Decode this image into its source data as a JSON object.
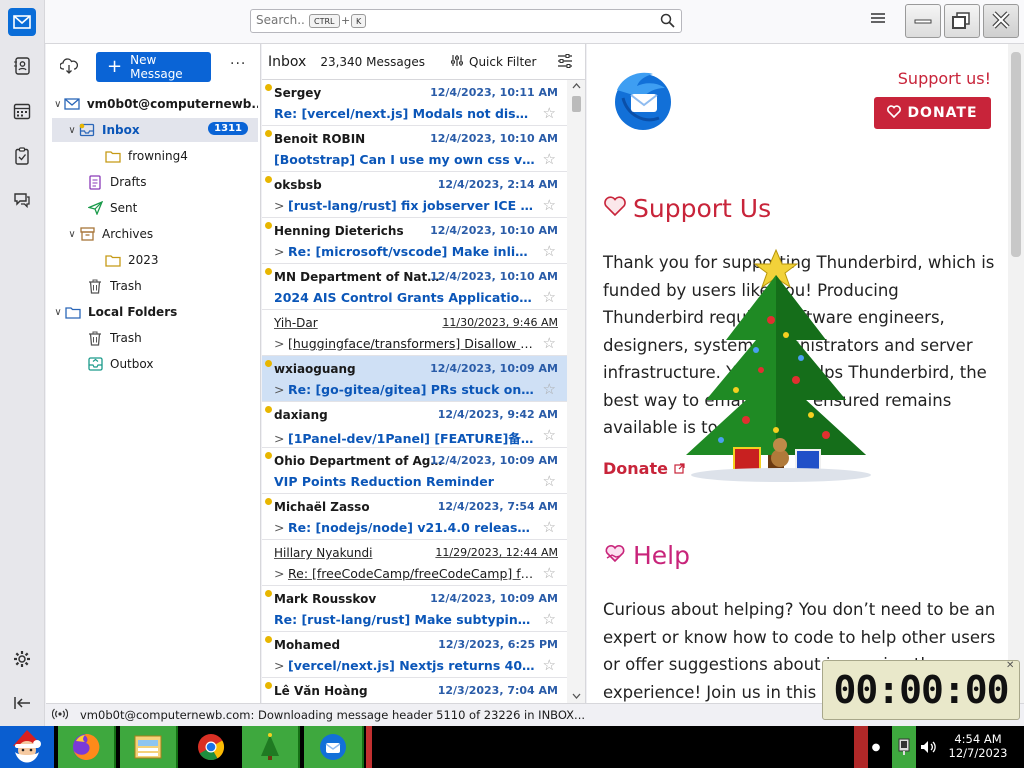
{
  "search": {
    "placeholder": "Search...",
    "kbd_ctrl": "CTRL",
    "kbd_plus": "+",
    "kbd_key": "K"
  },
  "folders": {
    "new_message": "New Message",
    "account": "vm0b0t@computernewb...",
    "items": [
      {
        "label": "Inbox",
        "badge": "1311"
      },
      {
        "label": "frowning4"
      },
      {
        "label": "Drafts"
      },
      {
        "label": "Sent"
      },
      {
        "label": "Archives"
      },
      {
        "label": "2023"
      },
      {
        "label": "Trash"
      },
      {
        "label": "Local Folders"
      },
      {
        "label": "Trash"
      },
      {
        "label": "Outbox"
      }
    ]
  },
  "threads": {
    "title": "Inbox",
    "count": "23,340 Messages",
    "quick_filter": "Quick Filter",
    "messages": [
      {
        "from": "Sergey",
        "date": "12/4/2023, 10:11 AM",
        "subject": "Re: [vercel/next.js] Modals not dismissi...",
        "unread": true,
        "thread": false
      },
      {
        "from": "Benoit ROBIN",
        "date": "12/4/2023, 10:10 AM",
        "subject": "[Bootstrap] Can I use my own css var ? (...",
        "unread": true,
        "thread": false
      },
      {
        "from": "oksbsb",
        "date": "12/4/2023, 2:14 AM",
        "subject": "[rust-lang/rust] fix jobserver ICE \"job...",
        "unread": true,
        "thread": true
      },
      {
        "from": "Henning Dieterichs",
        "date": "12/4/2023, 10:10 AM",
        "subject": "Re: [microsoft/vscode] Make inline c...",
        "unread": true,
        "thread": true
      },
      {
        "from": "MN Department of Natural ...",
        "date": "12/4/2023, 10:10 AM",
        "subject": "2024 AIS Control Grants Application Per...",
        "unread": true,
        "thread": false
      },
      {
        "from": "Yih-Dar",
        "date": "11/30/2023, 9:46 AM",
        "subject": "[huggingface/transformers] Disallow `pi...",
        "unread": false,
        "thread": true
      },
      {
        "from": "wxiaoguang",
        "date": "12/4/2023, 10:09 AM",
        "subject": "Re: [go-gitea/gitea] PRs stuck on \"M...",
        "unread": true,
        "thread": true,
        "selected": true
      },
      {
        "from": "daxiang",
        "date": "12/4/2023, 9:42 AM",
        "subject": "[1Panel-dev/1Panel] [FEATURE]备份...",
        "unread": true,
        "thread": true
      },
      {
        "from": "Ohio Department of Agricul...",
        "date": "12/4/2023, 10:09 AM",
        "subject": "VIP Points Reduction Reminder",
        "unread": true,
        "thread": false
      },
      {
        "from": "Michaël Zasso",
        "date": "12/4/2023, 7:54 AM",
        "subject": "Re: [nodejs/node] v21.4.0 release pro...",
        "unread": true,
        "thread": true
      },
      {
        "from": "Hillary Nyakundi",
        "date": "11/29/2023, 12:44 AM",
        "subject": "Re: [freeCodeCamp/freeCodeCamp] fea...",
        "unread": false,
        "thread": true
      },
      {
        "from": "Mark Rousskov",
        "date": "12/4/2023, 10:09 AM",
        "subject": "Re: [rust-lang/rust] Make subtyping exp...",
        "unread": true,
        "thread": false
      },
      {
        "from": "Mohamed",
        "date": "12/3/2023, 6:25 PM",
        "subject": "[vercel/next.js] Nextjs returns 404 err...",
        "unread": true,
        "thread": true
      },
      {
        "from": "Lê Văn Hoàng",
        "date": "12/3/2023, 7:04 AM",
        "subject": "",
        "unread": true,
        "thread": false
      }
    ]
  },
  "content": {
    "support_link": "Support us!",
    "donate_button": "DONATE",
    "support_heading": "Support Us",
    "support_text": "Thank you for supporting Thunderbird, which is funded by users like you! Producing Thunderbird requires software engineers, designers, system administrators and server infrastructure. Your gift helps Thunderbird, the best way to email, and it ensured remains available is to",
    "donate_link": "Donate",
    "help_heading": "Help",
    "help_text": "Curious about helping? You don’t need to be an expert or know how to code to help other users or offer suggestions about improving the experience! Join us in this c"
  },
  "status": {
    "text": "vm0b0t@computernewb.com: Downloading message header 5110 of 23226 in INBOX..."
  },
  "clock": {
    "display": "00:00:00"
  },
  "tray": {
    "time": "4:54 AM",
    "date": "12/7/2023"
  },
  "colors": {
    "accent": "#0a64d6",
    "brand_red": "#c8243a",
    "unread_dot": "#e8b600",
    "taskbar_green": "#3ea83e"
  }
}
